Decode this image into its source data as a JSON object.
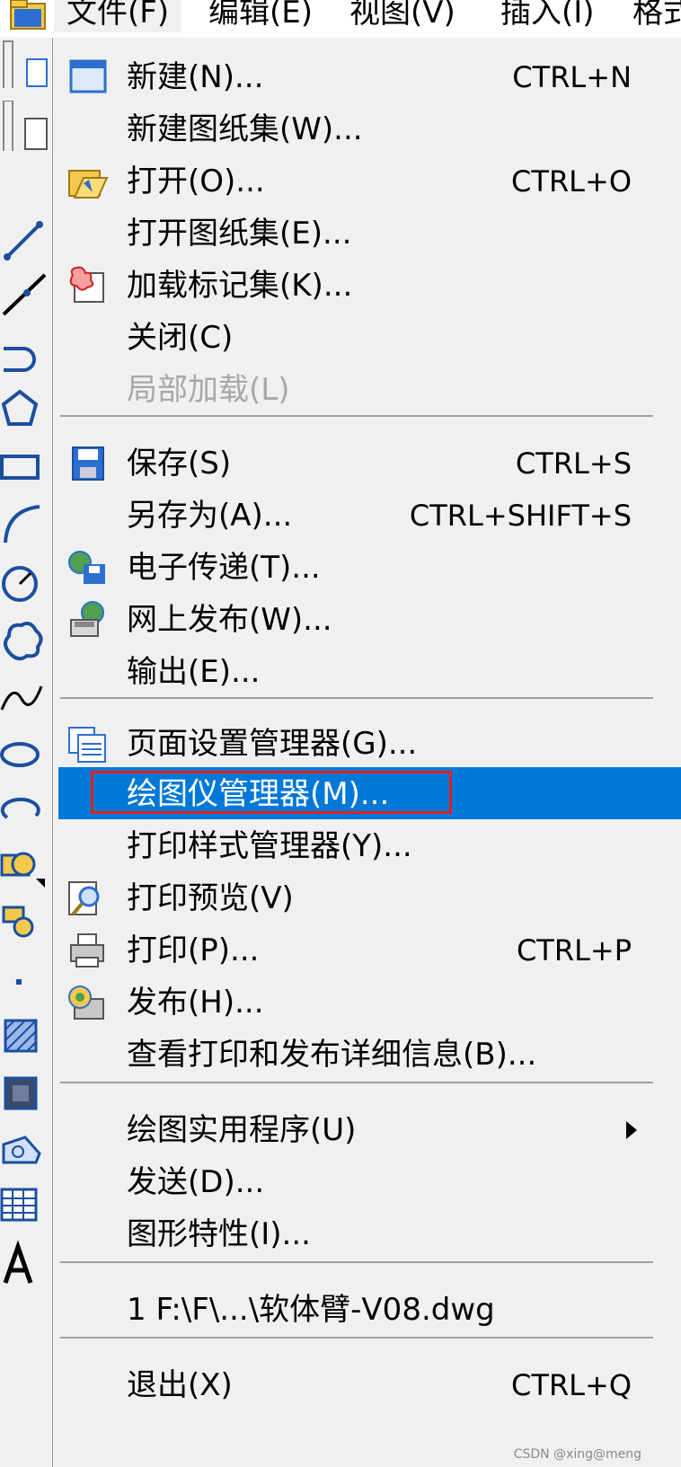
{
  "menubar": {
    "items": [
      {
        "label": "文件(F)",
        "active": true
      },
      {
        "label": "编辑(E)"
      },
      {
        "label": "视图(V)"
      },
      {
        "label": "插入(I)"
      },
      {
        "label": "格式"
      }
    ]
  },
  "toolbar": {
    "icons": [
      "line-icon",
      "polyline-icon",
      "rectangle-icon",
      "polygon-icon",
      "rectangle-icon",
      "arc-icon",
      "circle-icon",
      "revision-cloud-icon",
      "spline-icon",
      "ellipse-icon",
      "ellipse-arc-icon",
      "insert-block-icon",
      "make-block-icon",
      "point-icon",
      "hatch-icon",
      "gradient-icon",
      "region-icon",
      "table-icon",
      "multiline-text-icon"
    ]
  },
  "file_menu": {
    "items": [
      {
        "label": "新建(N)...",
        "shortcut": "CTRL+N",
        "icon": "new-file-icon"
      },
      {
        "label": "新建图纸集(W)..."
      },
      {
        "label": "打开(O)...",
        "shortcut": "CTRL+O",
        "icon": "open-folder-icon"
      },
      {
        "label": "打开图纸集(E)..."
      },
      {
        "label": "加载标记集(K)...",
        "icon": "markup-icon"
      },
      {
        "label": "关闭(C)"
      },
      {
        "label": "局部加载(L)",
        "disabled": true
      },
      {
        "label": "保存(S)",
        "shortcut": "CTRL+S",
        "icon": "save-icon"
      },
      {
        "label": "另存为(A)...",
        "shortcut": "CTRL+SHIFT+S"
      },
      {
        "label": "电子传递(T)...",
        "icon": "etransmit-icon"
      },
      {
        "label": "网上发布(W)...",
        "icon": "publish-web-icon"
      },
      {
        "label": "输出(E)..."
      },
      {
        "label": "页面设置管理器(G)...",
        "icon": "page-setup-icon"
      },
      {
        "label": "绘图仪管理器(M)...",
        "highlighted": true
      },
      {
        "label": "打印样式管理器(Y)..."
      },
      {
        "label": "打印预览(V)",
        "icon": "print-preview-icon"
      },
      {
        "label": "打印(P)...",
        "shortcut": "CTRL+P",
        "icon": "print-icon"
      },
      {
        "label": "发布(H)...",
        "icon": "publish-icon"
      },
      {
        "label": "查看打印和发布详细信息(B)..."
      },
      {
        "label": "绘图实用程序(U)",
        "submenu": true
      },
      {
        "label": "发送(D)..."
      },
      {
        "label": "图形特性(I)..."
      },
      {
        "label": "1 F:\\F\\...\\软体臂-V08.dwg"
      },
      {
        "label": "退出(X)",
        "shortcut": "CTRL+Q"
      }
    ]
  },
  "colors": {
    "highlight": "#0078d7",
    "annotation_box": "#e02020"
  },
  "watermark": "CSDN @xing@meng"
}
